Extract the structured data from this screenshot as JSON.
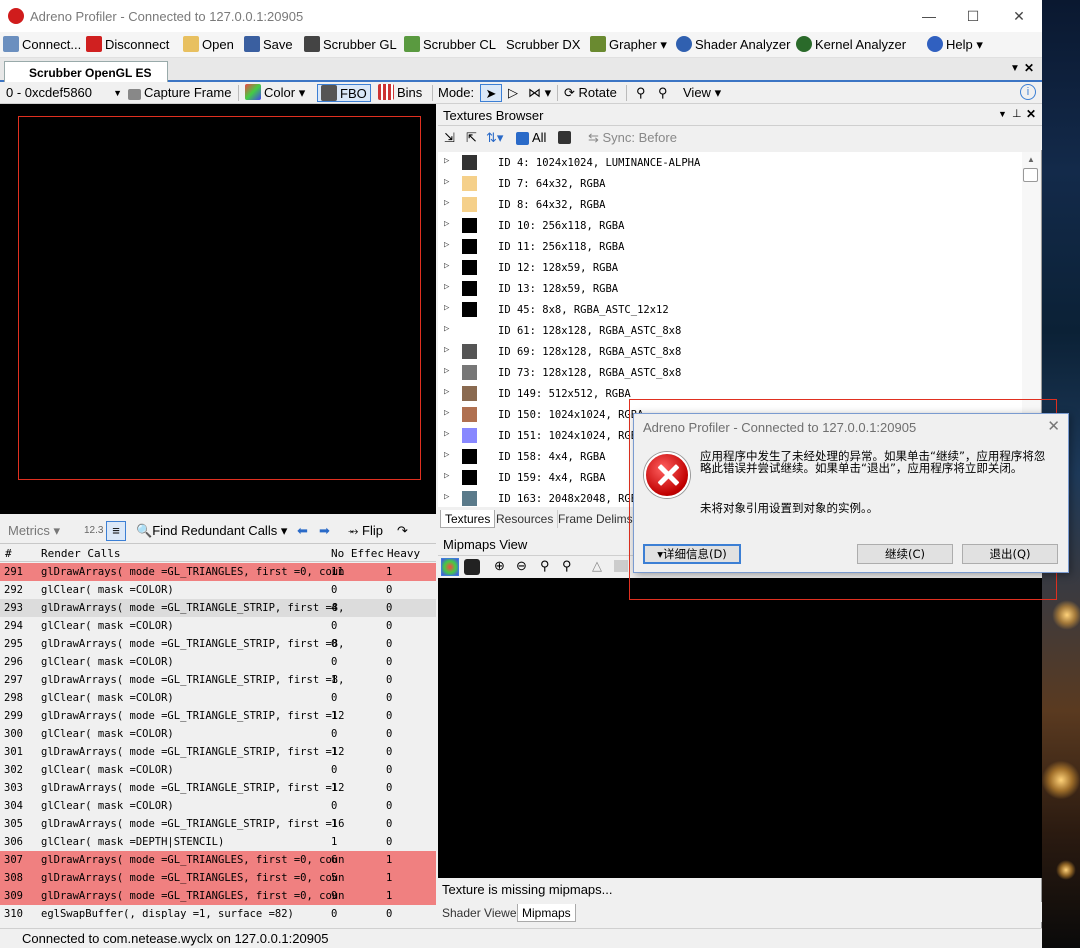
{
  "window": {
    "title": "Adreno Profiler - Connected to 127.0.0.1:20905"
  },
  "menu": [
    "Connect...",
    "Disconnect",
    "Open",
    "Save",
    "Scrubber GL",
    "Scrubber CL",
    "Scrubber DX",
    "Grapher",
    "Shader Analyzer",
    "Kernel Analyzer",
    "Help"
  ],
  "doc_tab": "Scrubber OpenGL ES (1)",
  "toolbar": {
    "context": "0 - 0xcdef5860",
    "capture": "Capture Frame",
    "color": "Color",
    "fbo": "FBO",
    "bins": "Bins",
    "mode": "Mode:",
    "rotate": "Rotate",
    "view": "View"
  },
  "metrics_bar": {
    "metrics": "Metrics",
    "num": "12.3",
    "find": "Find Redundant Calls",
    "flip": "Flip"
  },
  "calls_header": {
    "num": "#",
    "render": "Render Calls",
    "noeffect": "No Effec",
    "heavy": "Heavy"
  },
  "calls": [
    {
      "n": "291",
      "call": "glDrawArrays( mode =GL_TRIANGLES, first =0, coun",
      "ne": "11",
      "h": "1",
      "hl": true
    },
    {
      "n": "292",
      "call": "glClear( mask =COLOR)",
      "ne": "0",
      "h": "0"
    },
    {
      "n": "293",
      "call": "glDrawArrays( mode =GL_TRIANGLE_STRIP, first =8,",
      "ne": "4",
      "h": "0",
      "sel": true
    },
    {
      "n": "294",
      "call": "glClear( mask =COLOR)",
      "ne": "0",
      "h": "0"
    },
    {
      "n": "295",
      "call": "glDrawArrays( mode =GL_TRIANGLE_STRIP, first =8,",
      "ne": "0",
      "h": "0"
    },
    {
      "n": "296",
      "call": "glClear( mask =COLOR)",
      "ne": "0",
      "h": "0"
    },
    {
      "n": "297",
      "call": "glDrawArrays( mode =GL_TRIANGLE_STRIP, first =8,",
      "ne": "1",
      "h": "0"
    },
    {
      "n": "298",
      "call": "glClear( mask =COLOR)",
      "ne": "0",
      "h": "0"
    },
    {
      "n": "299",
      "call": "glDrawArrays( mode =GL_TRIANGLE_STRIP, first =12",
      "ne": "1",
      "h": "0"
    },
    {
      "n": "300",
      "call": "glClear( mask =COLOR)",
      "ne": "0",
      "h": "0"
    },
    {
      "n": "301",
      "call": "glDrawArrays( mode =GL_TRIANGLE_STRIP, first =12",
      "ne": "1",
      "h": "0"
    },
    {
      "n": "302",
      "call": "glClear( mask =COLOR)",
      "ne": "0",
      "h": "0"
    },
    {
      "n": "303",
      "call": "glDrawArrays( mode =GL_TRIANGLE_STRIP, first =12",
      "ne": "1",
      "h": "0"
    },
    {
      "n": "304",
      "call": "glClear( mask =COLOR)",
      "ne": "0",
      "h": "0"
    },
    {
      "n": "305",
      "call": "glDrawArrays( mode =GL_TRIANGLE_STRIP, first =16",
      "ne": "1",
      "h": "0"
    },
    {
      "n": "306",
      "call": "glClear( mask =DEPTH|STENCIL)",
      "ne": "1",
      "h": "0"
    },
    {
      "n": "307",
      "call": "glDrawArrays( mode =GL_TRIANGLES, first =0, coun",
      "ne": "6",
      "h": "1",
      "hl": true
    },
    {
      "n": "308",
      "call": "glDrawArrays( mode =GL_TRIANGLES, first =0, coun",
      "ne": "5",
      "h": "1",
      "hl": true
    },
    {
      "n": "309",
      "call": "glDrawArrays( mode =GL_TRIANGLES, first =0, coun",
      "ne": "9",
      "h": "1",
      "hl": true
    },
    {
      "n": "310",
      "call": "eglSwapBuffer(, display =1, surface =82)",
      "ne": "0",
      "h": "0"
    }
  ],
  "textures_title": "Textures Browser",
  "textures_toolbar": {
    "all": "All",
    "sync": "Sync: Before"
  },
  "textures": [
    {
      "label": "ID 4: 1024x1024, LUMINANCE-ALPHA",
      "thumb": "#333333"
    },
    {
      "label": "ID 7: 64x32, RGBA",
      "thumb": "#f5d08a"
    },
    {
      "label": "ID 8: 64x32, RGBA",
      "thumb": "#f5d08a"
    },
    {
      "label": "ID 10: 256x118, RGBA",
      "thumb": "#000000"
    },
    {
      "label": "ID 11: 256x118, RGBA",
      "thumb": "#000000"
    },
    {
      "label": "ID 12: 128x59, RGBA",
      "thumb": "#000000"
    },
    {
      "label": "ID 13: 128x59, RGBA",
      "thumb": "#000000"
    },
    {
      "label": "ID 45: 8x8, RGBA_ASTC_12x12",
      "thumb": "#000000"
    },
    {
      "label": "ID 61: 128x128, RGBA_ASTC_8x8",
      "thumb": "#ffffff"
    },
    {
      "label": "ID 69: 128x128, RGBA_ASTC_8x8",
      "thumb": "#555555"
    },
    {
      "label": "ID 73: 128x128, RGBA_ASTC_8x8",
      "thumb": "#777777"
    },
    {
      "label": "ID 149: 512x512, RGBA",
      "thumb": "#8a6a50"
    },
    {
      "label": "ID 150: 1024x1024, RGBA",
      "thumb": "#b07050"
    },
    {
      "label": "ID 151: 1024x1024, RGBA",
      "thumb": "#8888ff"
    },
    {
      "label": "ID 158: 4x4, RGBA",
      "thumb": "#000000"
    },
    {
      "label": "ID 159: 4x4, RGBA",
      "thumb": "#000000"
    },
    {
      "label": "ID 163: 2048x2048, RGBA",
      "thumb": "#5a7a8a"
    }
  ],
  "tex_tabs": [
    "Textures",
    "Resources",
    "Frame Delims"
  ],
  "mipmaps_title": "Mipmaps View",
  "mip_status": "Texture is missing mipmaps...",
  "bottom_tabs": [
    "Shader Viewer",
    "Mipmaps"
  ],
  "status": "Connected to com.netease.wyclx on 127.0.0.1:20905",
  "dialog": {
    "title": "Adreno Profiler - Connected to 127.0.0.1:20905",
    "message": "应用程序中发生了未经处理的异常。如果单击“继续”，应用程序将忽略此错误并尝试继续。如果单击“退出”，应用程序将立即关闭。",
    "detail": "未将对象引用设置到对象的实例。。",
    "details_btn": "▾详细信息(D)",
    "continue_btn": "继续(C)",
    "quit_btn": "退出(Q)"
  }
}
